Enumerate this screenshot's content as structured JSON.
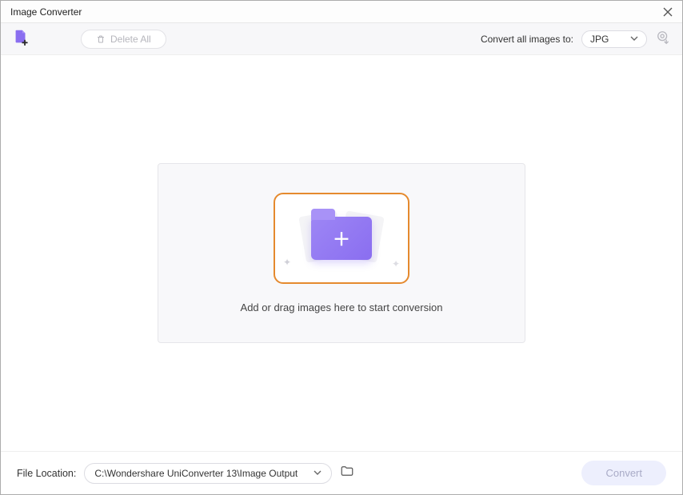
{
  "window": {
    "title": "Image Converter"
  },
  "toolbar": {
    "delete_all_label": "Delete All",
    "convert_to_label": "Convert all images to:",
    "format_value": "JPG"
  },
  "dropzone": {
    "hint": "Add or drag images here to start conversion"
  },
  "footer": {
    "file_location_label": "File Location:",
    "file_location_value": "C:\\Wondershare UniConverter 13\\Image Output",
    "convert_label": "Convert"
  }
}
